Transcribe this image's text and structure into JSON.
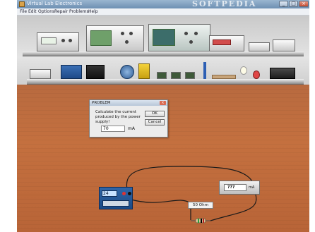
{
  "window": {
    "title": "Virtual Lab Electronics",
    "watermark": "SOFTPEDIA",
    "controls": [
      "_",
      "□",
      "×"
    ]
  },
  "menu": [
    "File",
    "Edit",
    "Options",
    "Repair",
    "Problems",
    "Help"
  ],
  "dialog": {
    "title": "PROBLEM",
    "prompt": "Calculate the current produced by the power supply!",
    "answer_value": "70",
    "unit": "mA",
    "ok_label": "OK",
    "cancel_label": "Cancel",
    "close_glyph": "×"
  },
  "bench": {
    "power_supply_display": "24",
    "meter_display": "???",
    "meter_unit": "mA",
    "resistor_label": "50 Ohm"
  },
  "colors": {
    "floor": "#c06c3d",
    "wire": "#1a1a1a",
    "power_supply": "#2a5b9c"
  }
}
